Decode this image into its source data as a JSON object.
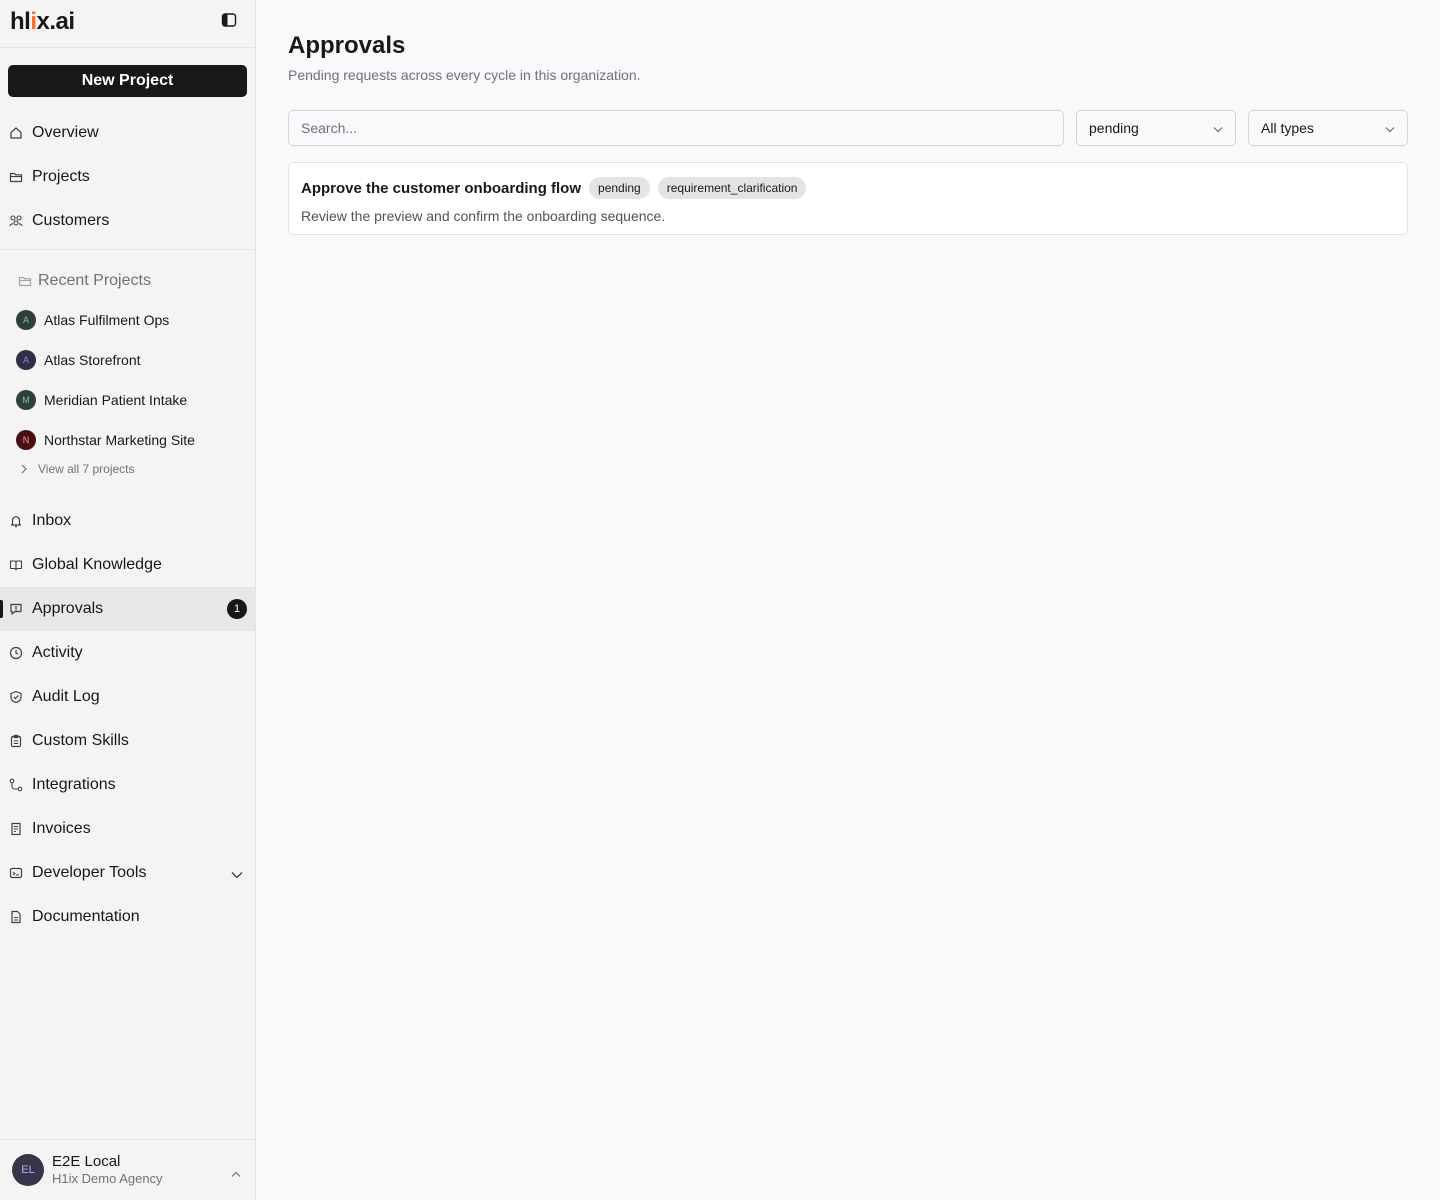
{
  "brand": {
    "logo_prefix": "hl",
    "logo_dot": "i",
    "logo_suffix": "x.ai",
    "accent": "#e8743b"
  },
  "sidebar": {
    "new_project_label": "New Project",
    "top_nav": [
      {
        "label": "Overview",
        "icon": "home-icon"
      },
      {
        "label": "Projects",
        "icon": "folder-icon"
      },
      {
        "label": "Customers",
        "icon": "users-icon"
      }
    ],
    "recent": {
      "heading": "Recent Projects",
      "items": [
        {
          "initial": "A",
          "label": "Atlas Fulfilment Ops",
          "color": "#2f3f3a",
          "text_color": "#7fbf9a"
        },
        {
          "initial": "A",
          "label": "Atlas Storefront",
          "color": "#2e2f45",
          "text_color": "#8d8cf0"
        },
        {
          "initial": "M",
          "label": "Meridian Patient Intake",
          "color": "#2f3f3a",
          "text_color": "#7fbf9a"
        },
        {
          "initial": "N",
          "label": "Northstar Marketing Site",
          "color": "#4a0f14",
          "text_color": "#f2a3a3"
        }
      ],
      "view_all": "View all 7 projects"
    },
    "bottom_nav": [
      {
        "label": "Inbox",
        "icon": "bell-icon"
      },
      {
        "label": "Global Knowledge",
        "icon": "book-icon"
      },
      {
        "label": "Approvals",
        "icon": "approval-icon",
        "badge": "1",
        "active": true
      },
      {
        "label": "Activity",
        "icon": "clock-icon"
      },
      {
        "label": "Audit Log",
        "icon": "shield-icon"
      },
      {
        "label": "Custom Skills",
        "icon": "clipboard-icon"
      },
      {
        "label": "Integrations",
        "icon": "workflow-icon"
      },
      {
        "label": "Invoices",
        "icon": "invoice-icon"
      },
      {
        "label": "Developer Tools",
        "icon": "terminal-icon",
        "expandable": true
      },
      {
        "label": "Documentation",
        "icon": "document-icon"
      }
    ],
    "user": {
      "initials": "EL",
      "name": "E2E Local",
      "org": "H1ix Demo Agency"
    }
  },
  "main": {
    "title": "Approvals",
    "subtitle": "Pending requests across every cycle in this organization.",
    "search_placeholder": "Search...",
    "status_filter": "pending",
    "type_filter": "All types",
    "approvals": [
      {
        "title": "Approve the customer onboarding flow",
        "status": "pending",
        "type": "requirement_clarification",
        "description": "Review the preview and confirm the onboarding sequence."
      }
    ]
  }
}
